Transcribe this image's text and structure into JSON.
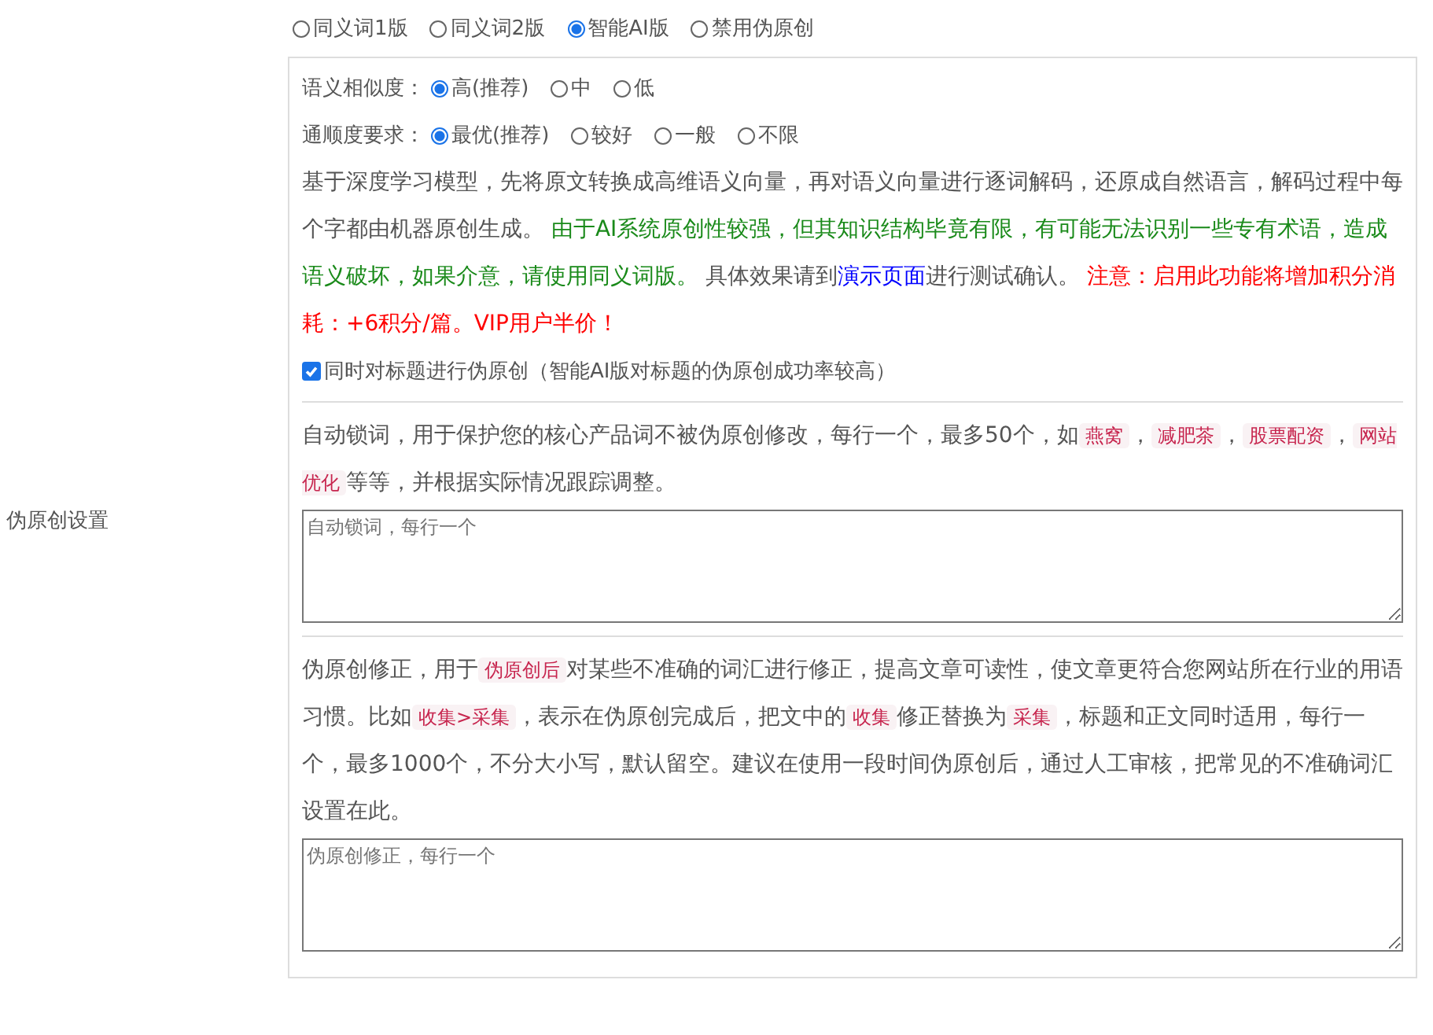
{
  "side_label": "伪原创设置",
  "mode_options": [
    {
      "label": "同义词1版",
      "selected": false
    },
    {
      "label": "同义词2版",
      "selected": false
    },
    {
      "label": "智能AI版",
      "selected": true
    },
    {
      "label": "禁用伪原创",
      "selected": false
    }
  ],
  "settings": [
    {
      "label": "语义相似度：",
      "options": [
        {
          "label": "高(推荐)",
          "selected": true
        },
        {
          "label": "中",
          "selected": false
        },
        {
          "label": "低",
          "selected": false
        }
      ]
    },
    {
      "label": "通顺度要求：",
      "options": [
        {
          "label": "最优(推荐)",
          "selected": true
        },
        {
          "label": "较好",
          "selected": false
        },
        {
          "label": "一般",
          "selected": false
        },
        {
          "label": "不限",
          "selected": false
        }
      ]
    }
  ],
  "ai_description": [
    {
      "kind": "text",
      "text": "基于深度学习模型，先将原文转换成高维语义向量，再对语义向量进行逐词解码，还原成自然语言，解码过程中每个字都由机器原创生成。 "
    },
    {
      "kind": "green",
      "text": "由于AI系统原创性较强，但其知识结构毕竟有限，有可能无法识别一些专有术语，造成语义破坏，如果介意，请使用同义词版。"
    },
    {
      "kind": "text",
      "text": " 具体效果请到"
    },
    {
      "kind": "link",
      "text": "演示页面"
    },
    {
      "kind": "text",
      "text": "进行测试确认。 "
    },
    {
      "kind": "red",
      "text": "注意：启用此功能将增加积分消耗：+6积分/篇。VIP用户半价！"
    }
  ],
  "title_option": {
    "label": "同时对标题进行伪原创（智能AI版对标题的伪原创成功率较高）",
    "checked": true
  },
  "lock_words": {
    "description": [
      {
        "kind": "text",
        "text": "自动锁词，用于保护您的核心产品词不被伪原创修改，每行一个，最多50个，如"
      },
      {
        "kind": "code",
        "text": "燕窝"
      },
      {
        "kind": "text",
        "text": "，"
      },
      {
        "kind": "code",
        "text": "减肥茶"
      },
      {
        "kind": "text",
        "text": "，"
      },
      {
        "kind": "code",
        "text": "股票配资"
      },
      {
        "kind": "text",
        "text": "，"
      },
      {
        "kind": "code",
        "text": "网站优化"
      },
      {
        "kind": "text",
        "text": "等等，并根据实际情况跟踪调整。"
      }
    ],
    "placeholder": "自动锁词，每行一个"
  },
  "corrections": {
    "description": [
      {
        "kind": "text",
        "text": "伪原创修正，用于"
      },
      {
        "kind": "code",
        "text": "伪原创后"
      },
      {
        "kind": "text",
        "text": "对某些不准确的词汇进行修正，提高文章可读性，使文章更符合您网站所在行业的用语习惯。比如"
      },
      {
        "kind": "code",
        "text": "收集>采集"
      },
      {
        "kind": "text",
        "text": "，表示在伪原创完成后，把文中的"
      },
      {
        "kind": "code",
        "text": "收集"
      },
      {
        "kind": "text",
        "text": "修正替换为"
      },
      {
        "kind": "code",
        "text": "采集"
      },
      {
        "kind": "text",
        "text": "，标题和正文同时适用，每行一个，最多1000个，不分大小写，默认留空。建议在使用一段时间伪原创后，通过人工审核，把常见的不准确词汇设置在此。"
      }
    ],
    "placeholder": "伪原创修正，每行一个"
  }
}
